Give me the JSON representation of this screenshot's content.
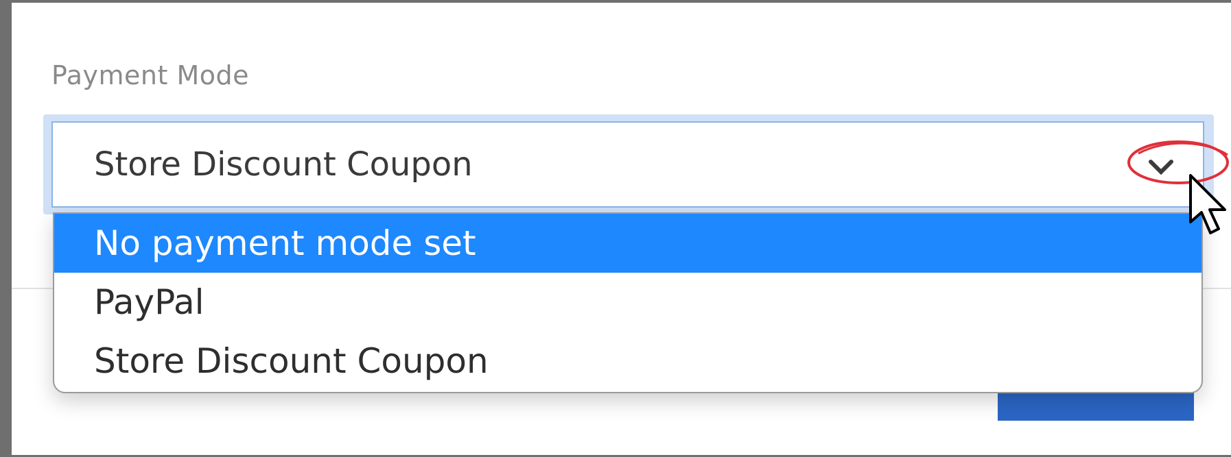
{
  "payment_mode": {
    "label": "Payment Mode",
    "selected_value": "Store Discount Coupon",
    "options": [
      {
        "label": "No payment mode set",
        "highlighted": true
      },
      {
        "label": "PayPal",
        "highlighted": false
      },
      {
        "label": "Store Discount Coupon",
        "highlighted": false
      }
    ]
  },
  "colors": {
    "highlight": "#1e88ff",
    "primary_button": "#2b66c6",
    "annotation": "#e0303a"
  },
  "icons": {
    "dropdown": "chevron-down-icon",
    "pointer": "mouse-cursor-icon"
  }
}
